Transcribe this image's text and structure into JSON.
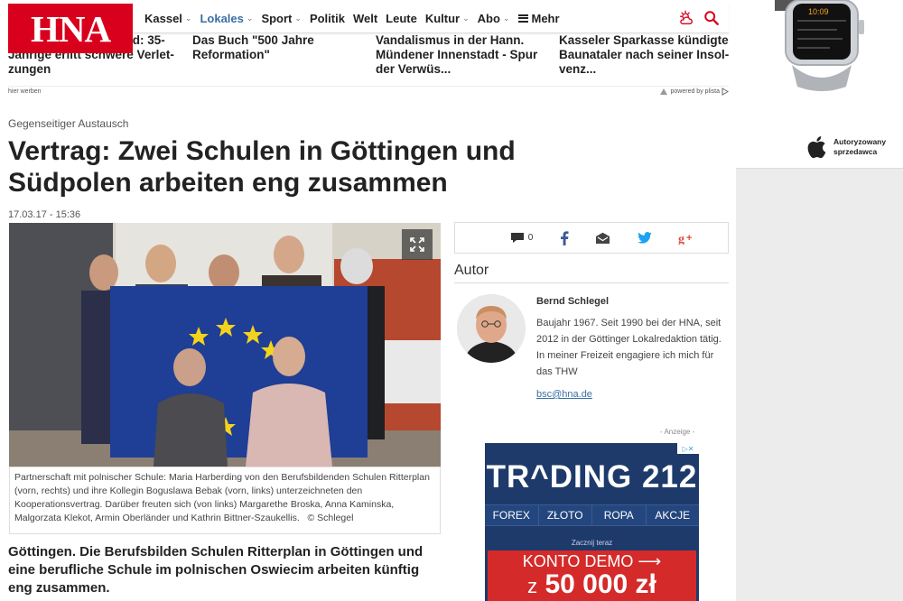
{
  "logo": "HNA",
  "nav": {
    "items": [
      {
        "label": "Kassel",
        "chevron": true,
        "active": false
      },
      {
        "label": "Lokales",
        "chevron": true,
        "active": true
      },
      {
        "label": "Sport",
        "chevron": true,
        "active": false
      },
      {
        "label": "Politik",
        "chevron": false,
        "active": false
      },
      {
        "label": "Welt",
        "chevron": false,
        "active": false
      },
      {
        "label": "Leute",
        "chevron": false,
        "active": false
      },
      {
        "label": "Kultur",
        "chevron": true,
        "active": false
      },
      {
        "label": "Abo",
        "chevron": true,
        "active": false
      }
    ],
    "more_label": "Mehr",
    "accent_color": "#d9001d"
  },
  "teasers": [
    {
      "line1": "ld: 35-",
      "line2": "Jährige erlitt schwere Verlet-",
      "line3": "zungen"
    },
    {
      "line1": "Das Buch \"500 Jahre",
      "line2": "Reformation\"",
      "line3": ""
    },
    {
      "line1": "Vandalismus in der Hann.",
      "line2": "Mündener Innenstadt - Spur",
      "line3": "der Verwüs..."
    },
    {
      "line1": "Kasseler Sparkasse kündigte",
      "line2": "Baunataler nach seiner Insol-",
      "line3": "venz..."
    }
  ],
  "ad_line": {
    "left": "hier werben",
    "right": "powered by plista"
  },
  "article": {
    "kicker": "Gegenseitiger Austausch",
    "headline_line1": "Vertrag: Zwei Schulen in Göttingen und",
    "headline_line2": "Südpolen arbeiten eng zusammen",
    "date": "17.03.17 - 15:36",
    "caption": "Partnerschaft mit polnischer Schule: Maria Harberding von den Berufsbildenden Schulen Ritterplan (vorn, rechts) und ihre Kollegin Boguslawa Bebak (vorn, links) unterzeichneten den Kooperationsvertrag. Darüber freuten sich (von links) Margarethe Broska, Anna Kaminska, Malgorzata Klekot, Armin Oberländer und Kathrin Bittner-Szaukellis.",
    "credit": "© Schlegel",
    "lead": "Göttingen. Die Berufsbilden Schulen Ritterplan in Göttingen und eine berufliche Schule im polnischen Oswiecim arbeiten künftig eng zusammen."
  },
  "share": {
    "comment_count": "0"
  },
  "author": {
    "heading": "Autor",
    "name": "Bernd Schlegel",
    "bio": "Baujahr 1967. Seit 1990 bei der HNA, seit 2012 in der Göttinger Lokalredaktion tätig. In meiner Freizeit engagiere ich mich für das THW",
    "email": "bsc@hna.de"
  },
  "ad": {
    "label": "- Anzeige -",
    "brand": "TR^DING 212",
    "markets": [
      "FOREX",
      "ZŁOTO",
      "ROPA",
      "AKCJE"
    ],
    "small": "Zacznij teraz",
    "cta1": "KONTO DEMO ⟶",
    "cta2_prefix": "z",
    "cta2_amount": "50 000 zł"
  },
  "watch_ad": {
    "time": "10:09",
    "authorized_line1": "Autoryzowany",
    "authorized_line2": "sprzedawca"
  }
}
